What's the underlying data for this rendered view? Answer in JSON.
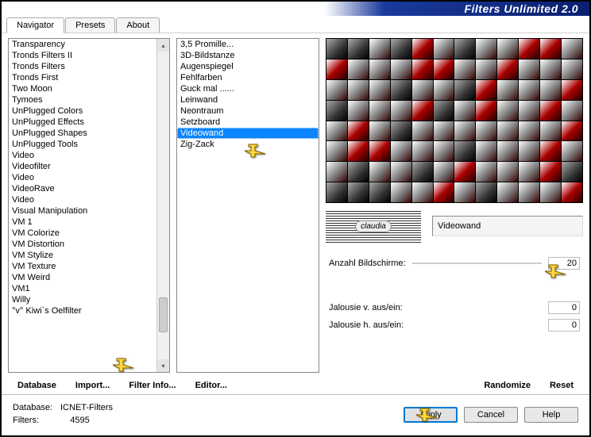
{
  "title": "Filters Unlimited 2.0",
  "tabs": [
    "Navigator",
    "Presets",
    "About"
  ],
  "activeTab": 0,
  "categories": [
    "Transparency",
    "Tronds Filters II",
    "Tronds Filters",
    "Tronds First",
    "Two Moon",
    "Tymoes",
    "UnPlugged Colors",
    "UnPlugged Effects",
    "UnPlugged Shapes",
    "UnPlugged Tools",
    "Video",
    "Videofilter",
    "Video",
    "VideoRave",
    "Video",
    "Visual Manipulation",
    "VM 1",
    "VM Colorize",
    "VM Distortion",
    "VM Stylize",
    "VM Texture",
    "VM Weird",
    "VM1",
    "Willy",
    "°v° Kiwi`s Oelfilter"
  ],
  "selectedCategoryIndex": 24,
  "filters": [
    "3,5 Promille...",
    "3D-Bildstanze",
    "Augenspiegel",
    "Fehlfarben",
    "Guck mal ......",
    "Leinwand",
    "Neontraum",
    "Setzboard",
    "Videowand",
    "Zig-Zack"
  ],
  "selectedFilterIndex": 8,
  "currentFilterName": "Videowand",
  "params": {
    "p1": {
      "label": "Anzahl Bildschirme:",
      "value": "20"
    },
    "p2": {
      "label": "Jalousie v. aus/ein:",
      "value": "0"
    },
    "p3": {
      "label": "Jalousie h. aus/ein:",
      "value": "0"
    }
  },
  "toolbar1": {
    "database": "Database",
    "import": "Import...",
    "filterinfo": "Filter Info...",
    "editor": "Editor..."
  },
  "toolbar2": {
    "randomize": "Randomize",
    "reset": "Reset"
  },
  "footer": {
    "dbLabel": "Database:",
    "dbValue": "ICNET-Filters",
    "filtersLabel": "Filters:",
    "filtersValue": "4595",
    "apply": "Apply",
    "cancel": "Cancel",
    "help": "Help"
  }
}
